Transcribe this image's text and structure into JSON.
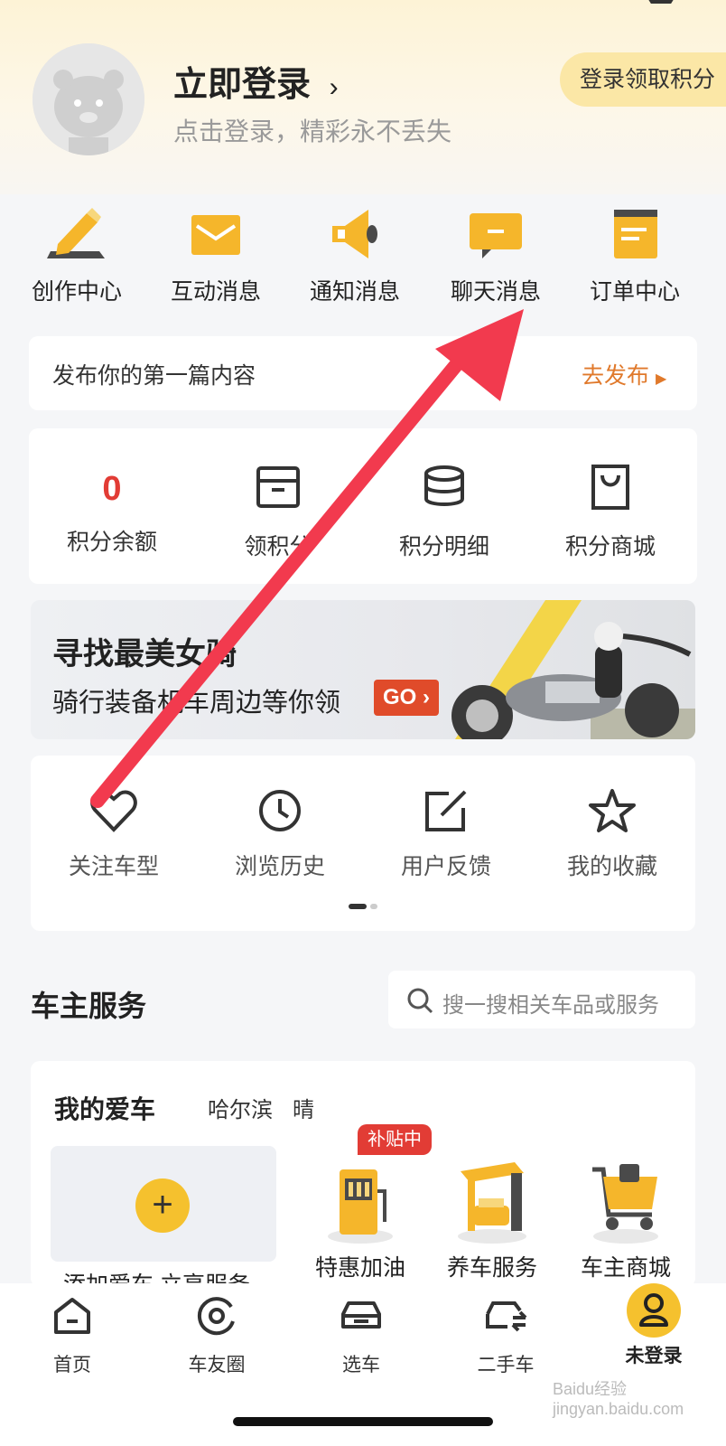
{
  "header": {
    "login_title": "立即登录",
    "login_subtitle": "点击登录，精彩永不丢失",
    "points_button": "登录领取积分"
  },
  "quick_actions": [
    {
      "label": "创作中心",
      "icon": "pen-icon"
    },
    {
      "label": "互动消息",
      "icon": "envelope-icon"
    },
    {
      "label": "通知消息",
      "icon": "megaphone-icon"
    },
    {
      "label": "聊天消息",
      "icon": "chat-bubble-icon"
    },
    {
      "label": "订单中心",
      "icon": "order-icon"
    }
  ],
  "publish_banner": {
    "text": "发布你的第一篇内容",
    "action": "去发布"
  },
  "points": {
    "balance_value": "0",
    "items": [
      {
        "label": "积分余额"
      },
      {
        "label": "领积分",
        "icon": "gift-box-icon"
      },
      {
        "label": "积分明细",
        "icon": "coins-icon"
      },
      {
        "label": "积分商城",
        "icon": "shopping-bag-icon"
      }
    ]
  },
  "promo": {
    "title": "寻找最美女骑",
    "subtitle": "骑行装备机车周边等你领",
    "cta": "GO"
  },
  "tools": [
    {
      "label": "关注车型",
      "icon": "heart-icon"
    },
    {
      "label": "浏览历史",
      "icon": "clock-icon"
    },
    {
      "label": "用户反馈",
      "icon": "edit-icon"
    },
    {
      "label": "我的收藏",
      "icon": "star-icon"
    }
  ],
  "owner_services": {
    "title": "车主服务",
    "search_placeholder": "搜一搜相关车品或服务",
    "my_car_title": "我的爱车",
    "city": "哈尔滨",
    "weather": "晴",
    "add_car_label": "添加爱车 立享服务",
    "services": [
      {
        "label": "特惠加油",
        "badge": "补贴中",
        "icon": "fuel-pump-icon"
      },
      {
        "label": "养车服务",
        "icon": "garage-icon"
      },
      {
        "label": "车主商城",
        "icon": "shopping-cart-icon"
      }
    ]
  },
  "bottom_nav": [
    {
      "label": "首页",
      "icon": "home-icon"
    },
    {
      "label": "车友圈",
      "icon": "circle-icon"
    },
    {
      "label": "选车",
      "icon": "car-icon"
    },
    {
      "label": "二手车",
      "icon": "used-car-icon"
    },
    {
      "label": "未登录",
      "icon": "user-icon"
    }
  ],
  "watermark": "Baidu经验 jingyan.baidu.com",
  "colors": {
    "accent_yellow": "#f5c12e",
    "accent_red": "#e23c35",
    "arrow_red": "#f23a4e"
  }
}
